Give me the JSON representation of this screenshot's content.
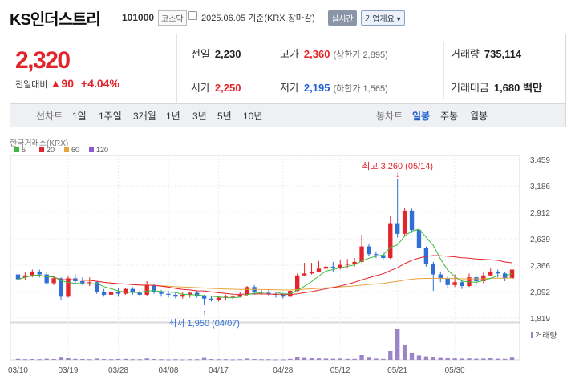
{
  "header": {
    "title": "KS인더스트리",
    "code": "101000",
    "market": "코스닥",
    "date": "2025.06.05 기준(KRX 장마감)",
    "realtime_label": "실시간",
    "company_label": "기업개요 ▾"
  },
  "quote": {
    "price": "2,320",
    "change_label": "전일대비",
    "change_arrow": "▲",
    "change_value": "90",
    "change_pct": "+4.04%",
    "prev_close": {
      "label": "전일",
      "value": "2,230"
    },
    "open": {
      "label": "시가",
      "value": "2,250"
    },
    "high": {
      "label": "고가",
      "value": "2,360",
      "sub": "(상한가 2,895)"
    },
    "low": {
      "label": "저가",
      "value": "2,195",
      "sub": "(하한가 1,565)"
    },
    "volume": {
      "label": "거래량",
      "value": "735,114"
    },
    "amount": {
      "label": "거래대금",
      "value": "1,680 백만"
    }
  },
  "tabs": {
    "line_label": "선차트",
    "periods": [
      "1일",
      "1주일",
      "3개월",
      "1년",
      "3년",
      "5년",
      "10년"
    ],
    "candle_label": "봉차트",
    "candle": [
      "일봉",
      "주봉",
      "월봉"
    ],
    "active_candle": "일봉"
  },
  "colors": {
    "up": "#e3242b",
    "down": "#2f6fd6",
    "ma5": "#3fba3f",
    "ma20": "#e3242b",
    "ma60": "#e8a33c",
    "ma120": "#8e5bc8",
    "volume": "#9b85c9"
  },
  "chart_data": {
    "type": "candlestick",
    "source_label": "한국거래소(KRX)",
    "legend": [
      "5",
      "20",
      "60",
      "120"
    ],
    "yticks": [
      "3,459",
      "3,186",
      "2,912",
      "2,639",
      "2,366",
      "2,092",
      "1,819"
    ],
    "ylim": [
      1819,
      3459
    ],
    "xticks": [
      "03/10",
      "03/19",
      "03/28",
      "04/08",
      "04/17",
      "04/28",
      "05/12",
      "05/21",
      "05/30"
    ],
    "high_label": "최고 3,260 (05/14)",
    "low_label": "최저 1,950 (04/07)",
    "volume_label": "거래량",
    "candles": [
      [
        2270,
        2220,
        2300,
        2180
      ],
      [
        2240,
        2260,
        2290,
        2210
      ],
      [
        2260,
        2300,
        2320,
        2240
      ],
      [
        2300,
        2270,
        2320,
        2240
      ],
      [
        2270,
        2180,
        2290,
        2160
      ],
      [
        2180,
        2230,
        2250,
        2160
      ],
      [
        2230,
        2040,
        2240,
        2000
      ],
      [
        2040,
        2230,
        2250,
        2030
      ],
      [
        2230,
        2200,
        2270,
        2180
      ],
      [
        2200,
        2180,
        2240,
        2160
      ],
      [
        2180,
        2190,
        2240,
        2150
      ],
      [
        2190,
        2090,
        2200,
        2070
      ],
      [
        2090,
        2060,
        2120,
        2040
      ],
      [
        2060,
        2090,
        2110,
        2050
      ],
      [
        2090,
        2070,
        2130,
        2040
      ],
      [
        2070,
        2120,
        2130,
        2060
      ],
      [
        2120,
        2080,
        2140,
        2060
      ],
      [
        2080,
        2060,
        2100,
        2040
      ],
      [
        2060,
        2160,
        2200,
        2050
      ],
      [
        2160,
        2090,
        2170,
        2070
      ],
      [
        2090,
        2070,
        2110,
        2040
      ],
      [
        2070,
        2060,
        2100,
        2030
      ],
      [
        2060,
        2040,
        2080,
        2020
      ],
      [
        2040,
        2060,
        2090,
        2020
      ],
      [
        2060,
        2080,
        2090,
        2030
      ],
      [
        2080,
        2050,
        2100,
        2030
      ],
      [
        2050,
        2020,
        2060,
        1950
      ],
      [
        2020,
        2010,
        2050,
        1990
      ],
      [
        2010,
        2030,
        2050,
        1990
      ],
      [
        2030,
        2040,
        2060,
        2000
      ],
      [
        2040,
        2040,
        2070,
        2010
      ],
      [
        2040,
        2060,
        2090,
        2030
      ],
      [
        2060,
        2140,
        2150,
        2050
      ],
      [
        2140,
        2090,
        2160,
        2060
      ],
      [
        2090,
        2080,
        2110,
        2060
      ],
      [
        2080,
        2070,
        2110,
        2050
      ],
      [
        2070,
        2060,
        2090,
        2030
      ],
      [
        2060,
        2040,
        2080,
        2020
      ],
      [
        2040,
        2100,
        2110,
        2030
      ],
      [
        2100,
        2260,
        2280,
        2090
      ],
      [
        2260,
        2280,
        2390,
        2250
      ],
      [
        2280,
        2300,
        2390,
        2270
      ],
      [
        2300,
        2330,
        2410,
        2290
      ],
      [
        2330,
        2350,
        2390,
        2310
      ],
      [
        2350,
        2340,
        2400,
        2300
      ],
      [
        2340,
        2370,
        2420,
        2320
      ],
      [
        2370,
        2380,
        2430,
        2330
      ],
      [
        2380,
        2400,
        2440,
        2350
      ],
      [
        2400,
        2560,
        2680,
        2390
      ],
      [
        2560,
        2480,
        2590,
        2460
      ],
      [
        2480,
        2470,
        2500,
        2440
      ],
      [
        2470,
        2440,
        2500,
        2420
      ],
      [
        2440,
        2800,
        2880,
        2430
      ],
      [
        2800,
        2690,
        3260,
        2650
      ],
      [
        2690,
        2930,
        2960,
        2670
      ],
      [
        2930,
        2730,
        2950,
        2700
      ],
      [
        2730,
        2540,
        2760,
        2500
      ],
      [
        2540,
        2380,
        2560,
        2350
      ],
      [
        2380,
        2270,
        2400,
        2100
      ],
      [
        2270,
        2230,
        2300,
        2190
      ],
      [
        2230,
        2160,
        2250,
        2130
      ],
      [
        2160,
        2190,
        2270,
        2140
      ],
      [
        2190,
        2150,
        2210,
        2120
      ],
      [
        2150,
        2240,
        2280,
        2140
      ],
      [
        2240,
        2200,
        2250,
        2170
      ],
      [
        2200,
        2260,
        2290,
        2180
      ],
      [
        2260,
        2300,
        2330,
        2250
      ],
      [
        2300,
        2280,
        2320,
        2240
      ],
      [
        2280,
        2230,
        2300,
        2200
      ],
      [
        2230,
        2320,
        2360,
        2195
      ]
    ],
    "volume": [
      6,
      4,
      5,
      4,
      7,
      5,
      14,
      10,
      6,
      5,
      4,
      8,
      5,
      4,
      5,
      6,
      4,
      4,
      9,
      5,
      4,
      3,
      4,
      3,
      4,
      4,
      12,
      5,
      4,
      4,
      3,
      4,
      8,
      5,
      4,
      4,
      3,
      3,
      6,
      20,
      12,
      10,
      9,
      8,
      7,
      8,
      6,
      6,
      30,
      14,
      8,
      6,
      55,
      190,
      90,
      40,
      28,
      22,
      18,
      12,
      10,
      9,
      8,
      9,
      7,
      8,
      10,
      7,
      6,
      14
    ]
  }
}
